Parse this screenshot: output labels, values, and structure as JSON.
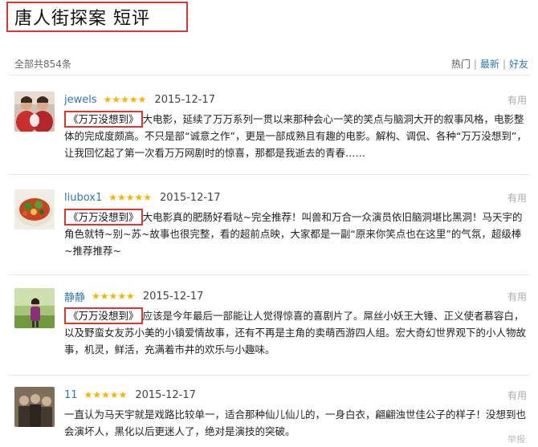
{
  "page": {
    "title": "唐人街探案 短评",
    "total": "全部共854条"
  },
  "sort": {
    "hot": "热门",
    "latest": "最新",
    "friends": "好友",
    "sep": "|"
  },
  "stars_glyph": "★★★★★",
  "reviews": [
    {
      "user": "jewels",
      "date": "2015-12-17",
      "useful": "有用",
      "movie_tag": "《万万没想到》",
      "text": "大电影，延续了万万系列一贯以来那种会心一笑的笑点与脑洞大开的叙事风格，电影整体的完成度颇高。不只是部“诚意之作”，更是一部成熟且有趣的电影。解构、调侃、各种“万万没想到”，让我回忆起了第一次看万万网剧时的惊喜，那都是我逝去的青春……",
      "avatar": "two-people-photo"
    },
    {
      "user": "liubox1",
      "date": "2015-12-17",
      "useful": "有用",
      "movie_tag": "《万万没想到》",
      "text": "大电影真的肥肠好看哒~完全推荐！叫兽和万合一众演员依旧脑洞堪比黑洞！马天宇的角色就特~别~苏~故事也很完整，看的超前点映，大家都是一副“原来你笑点也在这里”的气氛，超级棒~推荐推荐~",
      "avatar": "food-bowl-photo"
    },
    {
      "user": "静静",
      "date": "2015-12-17",
      "useful": "有用",
      "movie_tag": "《万万没想到》",
      "text": "应该是今年最后一部能让人觉得惊喜的喜剧片了。屌丝小妖王大锤、正义使者慕容白，以及野蛮女友苏小美的小镇爱情故事，还有不再是主角的卖萌西游四人组。宏大奇幻世界观下的小人物故事，机灵，鲜活，充满着市井的欢乐与小趣味。",
      "avatar": "woman-outdoor-photo"
    },
    {
      "user": "11",
      "date": "2015-12-17",
      "useful": "有用",
      "movie_tag": "",
      "text": "一直认为马天宇就是戏路比较单一，适合那种仙儿仙儿的，一身白衣，翩翩浊世佳公子的样子！没想到也会演坏人，黑化以后更迷人了，绝对是演技的突破。",
      "avatar": "group-photo"
    }
  ],
  "report": "举报",
  "colors": {
    "accent_red": "#d9372f",
    "link_blue": "#3377aa",
    "star_gold": "#f5b400"
  }
}
